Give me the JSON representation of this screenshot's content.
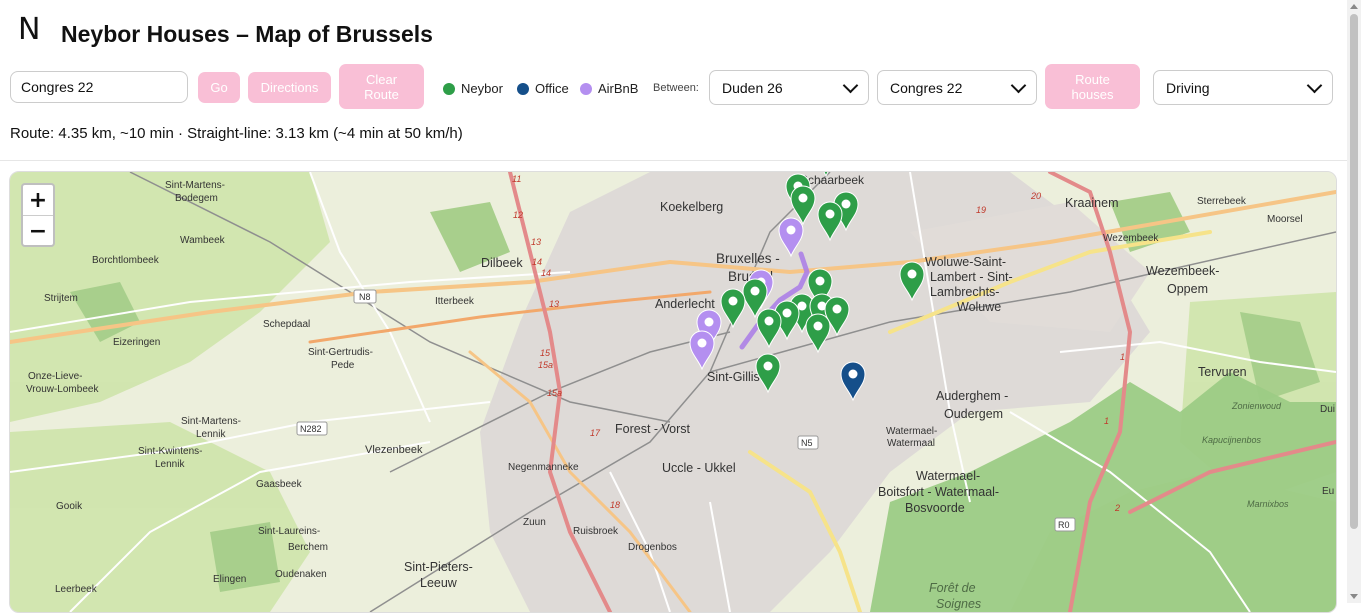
{
  "header": {
    "logo_text": "N",
    "title": "Neybor Houses – Map of Brussels"
  },
  "toolbar": {
    "search_value": "Congres 22",
    "go_label": "Go",
    "directions_label": "Directions",
    "clear_route_label": "Clear Route",
    "route_houses_label": "Route houses",
    "between_label": "Between:",
    "from_selected": "Duden 26",
    "to_selected": "Congres 22",
    "mode_selected": "Driving"
  },
  "legend": [
    {
      "label": "Neybor",
      "color": "#2e9e48"
    },
    {
      "label": "Office",
      "color": "#154f8a"
    },
    {
      "label": "AirBnB",
      "color": "#b48ff0"
    }
  ],
  "route_info": "Route: 4.35 km, ~10 min · Straight-line: 3.13 km (~4 min at 50 km/h)",
  "map": {
    "zoom_in": "+",
    "zoom_out": "−",
    "labels": {
      "schaerbeek": "Schaarbeek",
      "koekelberg": "Koekelberg",
      "sint_martens_bodegem_1": "Sint-Martens-",
      "sint_martens_bodegem_2": "Bodegem",
      "wambeek": "Wambeek",
      "borchtlombeek": "Borchtlombeek",
      "dilbeek": "Dilbeek",
      "strijtem": "Strijtem",
      "itterbeek": "Itterbeek",
      "schepdaal": "Schepdaal",
      "eizeringen": "Eizeringen",
      "sint_gertrudis_1": "Sint-Gertrudis-",
      "sint_gertrudis_2": "Pede",
      "onze_lieve_1": "Onze-Lieve-",
      "onze_lieve_2": "Vrouw-Lombeek",
      "sint_martens_lennik_1": "Sint-Martens-",
      "sint_martens_lennik_2": "Lennik",
      "sint_kwintens_1": "Sint-Kwintens-",
      "sint_kwintens_2": "Lennik",
      "vlezenbeek": "Vlezenbeek",
      "gaasbeek": "Gaasbeek",
      "gooik": "Gooik",
      "sint_laureins_1": "Sint-Laureins-",
      "sint_laureins_2": "Berchem",
      "elingen": "Elingen",
      "oudenaken": "Oudenaken",
      "leerbeek": "Leerbeek",
      "sint_pieters_1": "Sint-Pieters-",
      "sint_pieters_2": "Leeuw",
      "zuun": "Zuun",
      "ruisbroek": "Ruisbroek",
      "drogenbos": "Drogenbos",
      "negenmanneke": "Negenmanneke",
      "anderlecht": "Anderlecht",
      "bruxelles_1": "Bruxelles -",
      "bruxelles_2": "Brussel",
      "sint_gillis": "Sint-Gillis",
      "forest": "Forest - Vorst",
      "uccle": "Uccle - Ukkel",
      "woluwe_1": "Woluwe-Saint-",
      "woluwe_2": "Lambert - Sint-",
      "woluwe_3": "Lambrechts-",
      "woluwe_4": "Woluwe",
      "kraainem": "Kraainem",
      "sterrebeek": "Sterrebeek",
      "moorsel": "Moorsel",
      "wezembeek": "Wezembeek",
      "wezembeek_oppem_1": "Wezembeek-",
      "wezembeek_oppem_2": "Oppem",
      "tervuren": "Tervuren",
      "auderghem_1": "Auderghem -",
      "auderghem_2": "Oudergem",
      "watermael_a": "Watermael-",
      "watermael_b": "Watermaal",
      "watermael_boitsfort_1": "Watermael-",
      "watermael_boitsfort_2": "Boitsfort - Watermaal-",
      "watermael_boitsfort_3": "Bosvoorde",
      "zonienwoud": "Zonienwoud",
      "kapucijnenbos": "Kapucijnenbos",
      "marnixbos": "Marnixbos",
      "foret_1": "Forêt de",
      "foret_2": "Soignes",
      "dui": "Dui",
      "eux": "Eu",
      "n8": "N8",
      "n282": "N282",
      "n5": "N5",
      "r0": "R0",
      "e11": "11",
      "e12": "12",
      "e13": "13",
      "e13b": "13",
      "e14": "14",
      "e14b": "14",
      "e15": "15",
      "e15a": "15a",
      "e15a2": "15a",
      "e17": "17",
      "e18": "18",
      "e19": "19",
      "e20": "20",
      "e1": "1",
      "e2": "2",
      "e1b": "1"
    }
  }
}
